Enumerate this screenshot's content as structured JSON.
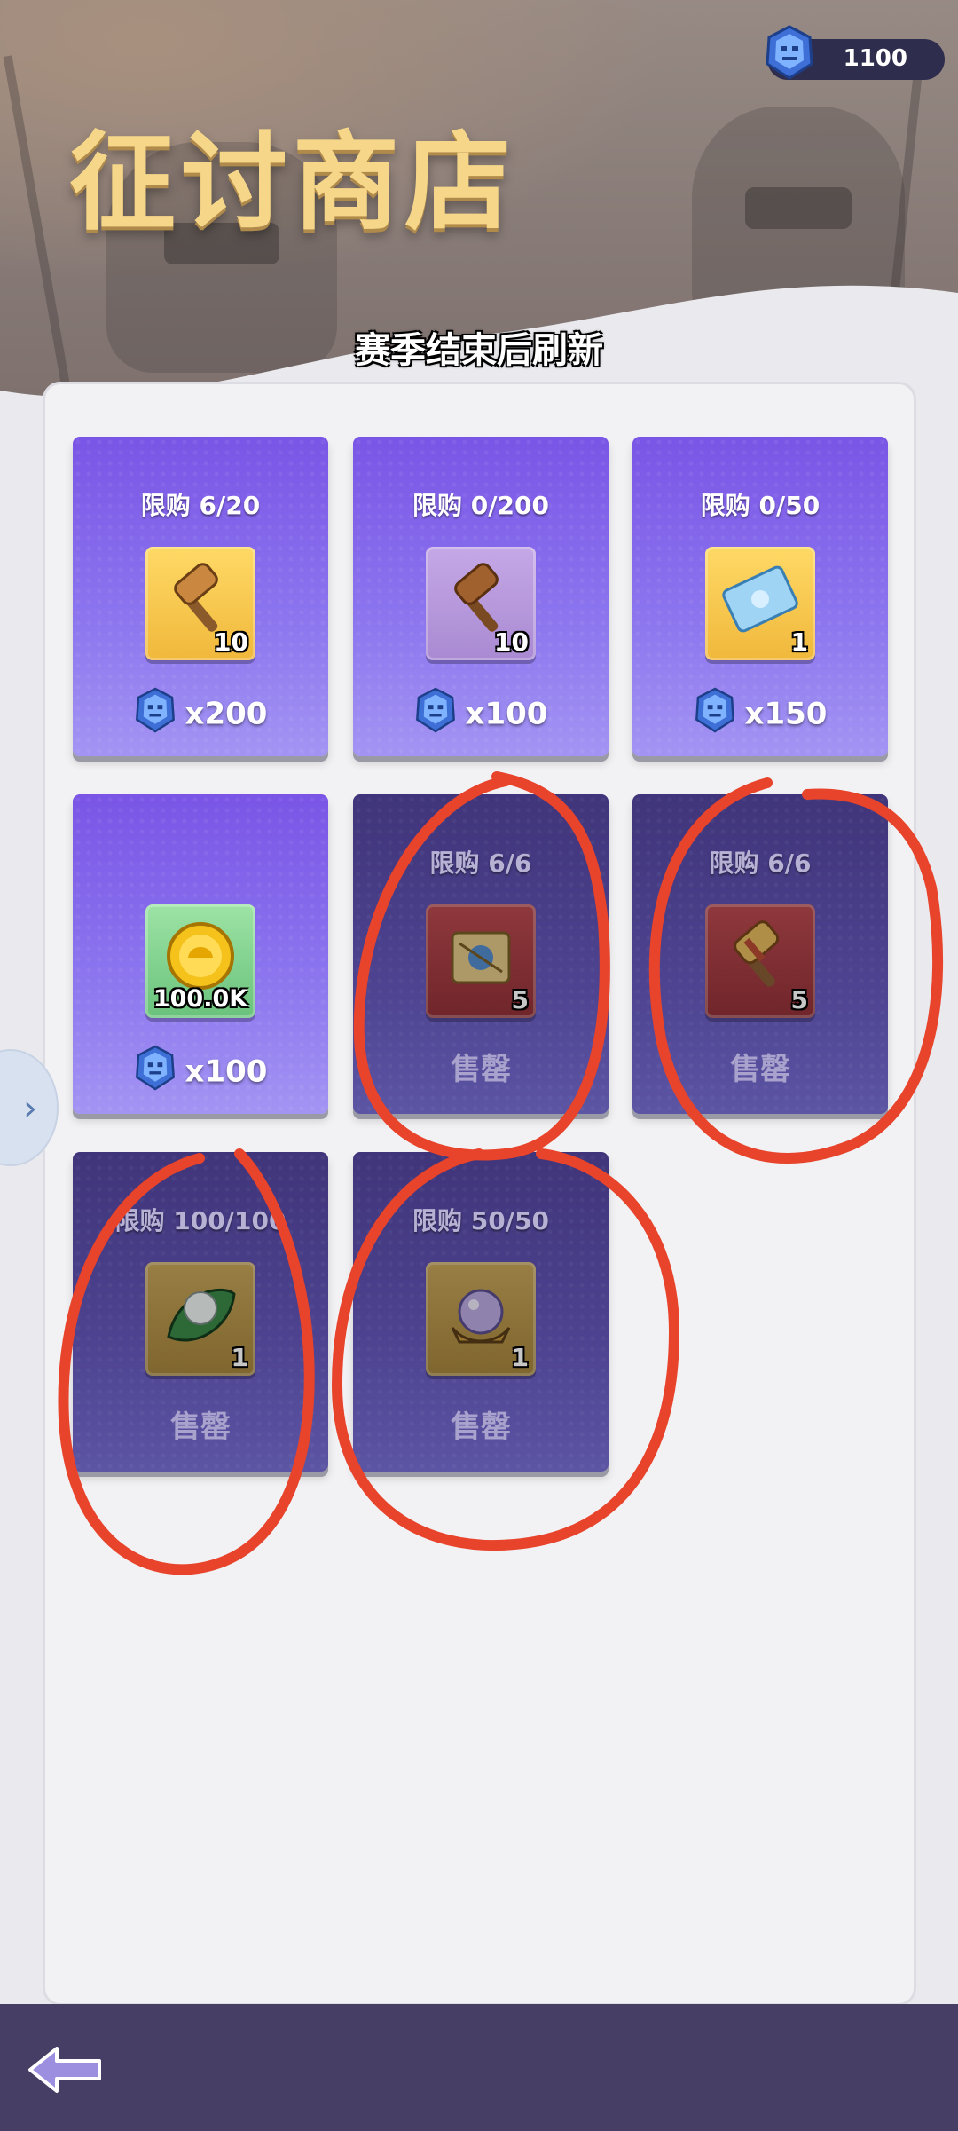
{
  "header": {
    "title": "征讨商店",
    "refresh_note": "赛季结束后刷新",
    "currency": {
      "icon": "blue-gem-icon",
      "amount": "1100"
    }
  },
  "shop_items": [
    {
      "limit": "限购 6/20",
      "icon": "gold-hammer-icon",
      "frame": "gold",
      "quantity": "10",
      "price": "x200",
      "sold_out": false
    },
    {
      "limit": "限购 0/200",
      "icon": "wooden-hammer-icon",
      "frame": "purple",
      "quantity": "10",
      "price": "x100",
      "sold_out": false
    },
    {
      "limit": "限购 0/50",
      "icon": "ticket-icon",
      "frame": "gold",
      "quantity": "1",
      "price": "x150",
      "sold_out": false
    },
    {
      "limit": "",
      "icon": "gold-coin-icon",
      "frame": "green",
      "quantity": "100.0K",
      "price": "x100",
      "sold_out": false
    },
    {
      "limit": "限购 6/6",
      "icon": "scroll-map-icon",
      "frame": "red",
      "quantity": "5",
      "price": "",
      "sold_label": "售罄",
      "sold_out": true
    },
    {
      "limit": "限购 6/6",
      "icon": "red-hammer-icon",
      "frame": "red",
      "quantity": "5",
      "price": "",
      "sold_label": "售罄",
      "sold_out": true
    },
    {
      "limit": "限购 100/100",
      "icon": "pearl-leaf-icon",
      "frame": "goldmuted",
      "quantity": "1",
      "price": "",
      "sold_label": "售罄",
      "sold_out": true
    },
    {
      "limit": "限购 50/50",
      "icon": "crystal-ball-icon",
      "frame": "goldmuted",
      "quantity": "1",
      "price": "",
      "sold_label": "售罄",
      "sold_out": true
    }
  ],
  "colors": {
    "title_gold": "#f6d78a",
    "card_active": "#7a55e6",
    "card_soldout": "#40357a",
    "annotation_red": "#e8432b",
    "bottom_bar": "#463e64"
  },
  "navigation": {
    "back_icon": "back-arrow-icon",
    "side_tab_icon": "chevron-right-icon"
  }
}
